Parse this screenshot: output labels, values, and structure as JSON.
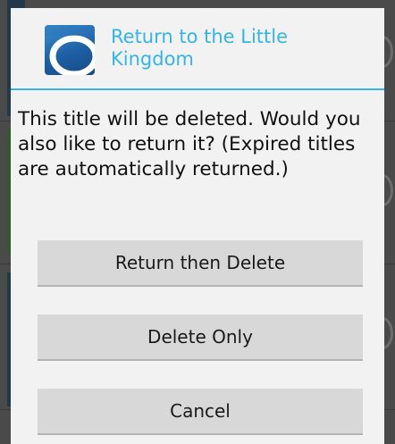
{
  "dialog": {
    "title": "Return to the Little Kingdom",
    "message": "This title will be deleted. Would you also like to return it? (Expired titles are automatically returned.)",
    "app_icon": "overdrive-app-icon",
    "accent_color": "#33b5e5"
  },
  "buttons": {
    "return_then_delete": "Return then Delete",
    "delete_only": "Delete Only",
    "cancel": "Cancel"
  }
}
